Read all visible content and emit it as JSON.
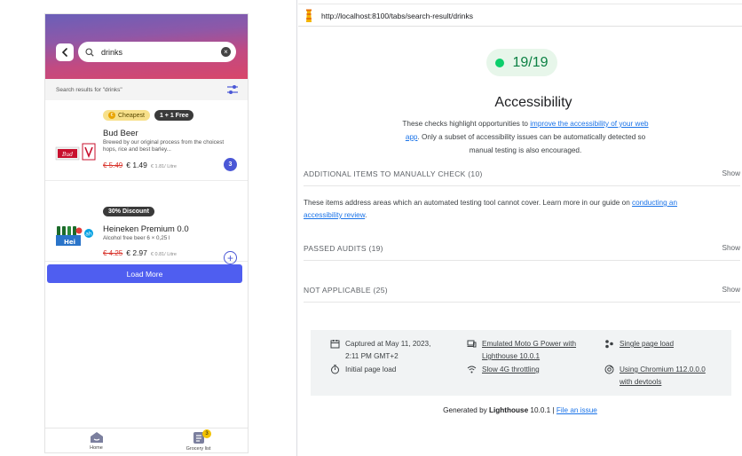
{
  "app": {
    "search": {
      "query": "drinks"
    },
    "results_label": "Search results for \"drinks\"",
    "products": [
      {
        "badges": [
          "Cheapest",
          "1 + 1 Free"
        ],
        "name": "Bud Beer",
        "description": "Brewed by our original process from the choicest hops, rice and best barley...",
        "old_price": "€ 5.49",
        "price": "€ 1.49",
        "unit_price": "€ 1.81/ Litre",
        "cart_qty": "3"
      },
      {
        "badges": [
          "30% Discount"
        ],
        "name": "Heineken Premium 0.0",
        "description": "Alcohol free beer 6 × 0,25 l",
        "old_price": "€ 4.25",
        "price": "€ 2.97",
        "unit_price": "€ 0.81/ Litre",
        "cart_qty": ""
      }
    ],
    "load_more": "Load More",
    "tabs": [
      {
        "label": "Home",
        "icon": "home-icon"
      },
      {
        "label": "Grocery list",
        "icon": "grocery-list-icon",
        "badge": "3"
      }
    ]
  },
  "browser": {
    "url": "http://localhost:8100/tabs/search-result/drinks"
  },
  "report": {
    "score": "19/19",
    "score_color": "#0cce6b",
    "category_title": "Accessibility",
    "category_desc_pre": "These checks highlight opportunities to ",
    "category_desc_link": "improve the accessibility of your web app",
    "category_desc_post": ". Only a subset of accessibility issues can be automatically detected so manual testing is also encouraged.",
    "groups": [
      {
        "title": "ADDITIONAL ITEMS TO MANUALLY CHECK",
        "count": "(10)",
        "action": "Show"
      },
      {
        "title": "PASSED AUDITS",
        "count": "(19)",
        "action": "Show"
      },
      {
        "title": "NOT APPLICABLE",
        "count": "(25)",
        "action": "Show"
      }
    ],
    "manual_desc_pre": "These items address areas which an automated testing tool cannot cover. Learn more in our guide on ",
    "manual_desc_link": "conducting an accessibility review",
    "manual_desc_post": ".",
    "env": {
      "captured": "Captured at May 11, 2023, 2:11 PM GMT+2",
      "initial_load": "Initial page load",
      "device": "Emulated Moto G Power with Lighthouse 10.0.1",
      "throttling": "Slow 4G throttling",
      "session": "Single page load",
      "browser": "Using Chromium 112.0.0.0 with devtools"
    },
    "footer": {
      "generated_by": "Generated by ",
      "tool": "Lighthouse",
      "version": " 10.0.1 | ",
      "file_issue": "File an issue"
    }
  }
}
